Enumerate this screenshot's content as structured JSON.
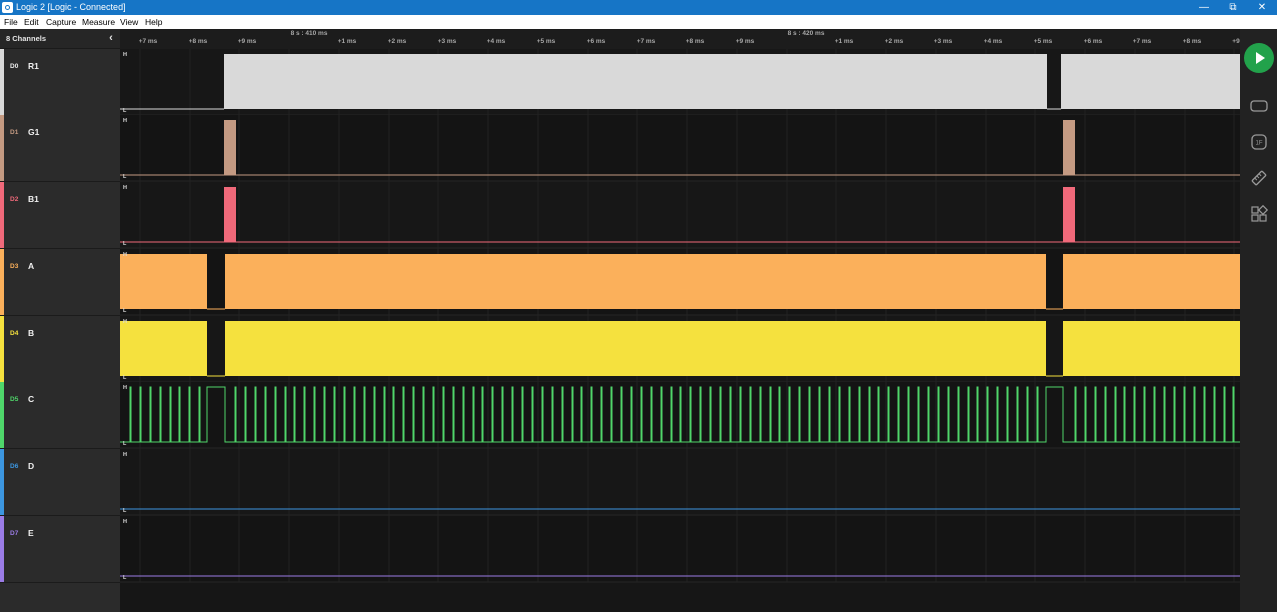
{
  "window": {
    "title": "Logic 2 [Logic - Connected]"
  },
  "titlebar_controls": [
    "minimize",
    "restore",
    "close"
  ],
  "menu": [
    "File",
    "Edit",
    "Capture",
    "Measure",
    "View",
    "Help"
  ],
  "sidebar": {
    "header": "8 Channels",
    "collapse_icon": "chevron-left-icon",
    "channels": [
      {
        "id": "D0",
        "name": "R1",
        "color": "#d9d9d9",
        "id_color": "#eeeeee"
      },
      {
        "id": "D1",
        "name": "G1",
        "color": "#c49a82",
        "id_color": "#c49a82"
      },
      {
        "id": "D2",
        "name": "B1",
        "color": "#f0697a",
        "id_color": "#f0697a"
      },
      {
        "id": "D3",
        "name": "A",
        "color": "#fbb05b",
        "id_color": "#fbb05b"
      },
      {
        "id": "D4",
        "name": "B",
        "color": "#f5e13e",
        "id_color": "#f5e13e"
      },
      {
        "id": "D5",
        "name": "C",
        "color": "#4fd66a",
        "id_color": "#4fd66a"
      },
      {
        "id": "D6",
        "name": "D",
        "color": "#3c96e0",
        "id_color": "#3c96e0"
      },
      {
        "id": "D7",
        "name": "E",
        "color": "#9b7ce6",
        "id_color": "#9b7ce6"
      }
    ]
  },
  "timeline": {
    "major_labels": [
      "8 s : 410 ms",
      "8 s : 420 ms"
    ],
    "tick_labels": [
      "+7 ms",
      "+8 ms",
      "+9 ms",
      "+1 ms",
      "+2 ms",
      "+3 ms",
      "+4 ms",
      "+5 ms",
      "+6 ms",
      "+7 ms",
      "+8 ms",
      "+9 ms",
      "+1 ms",
      "+2 ms",
      "+3 ms",
      "+4 ms",
      "+5 ms",
      "+6 ms",
      "+7 ms",
      "+8 ms",
      "+9"
    ]
  },
  "level_labels": {
    "high": "H",
    "low": "L"
  },
  "right_panel": {
    "play_icon": "play-icon",
    "icons": [
      "analyzers-icon",
      "extensions-icon",
      "measure-ruler-icon",
      "layout-icon"
    ]
  }
}
